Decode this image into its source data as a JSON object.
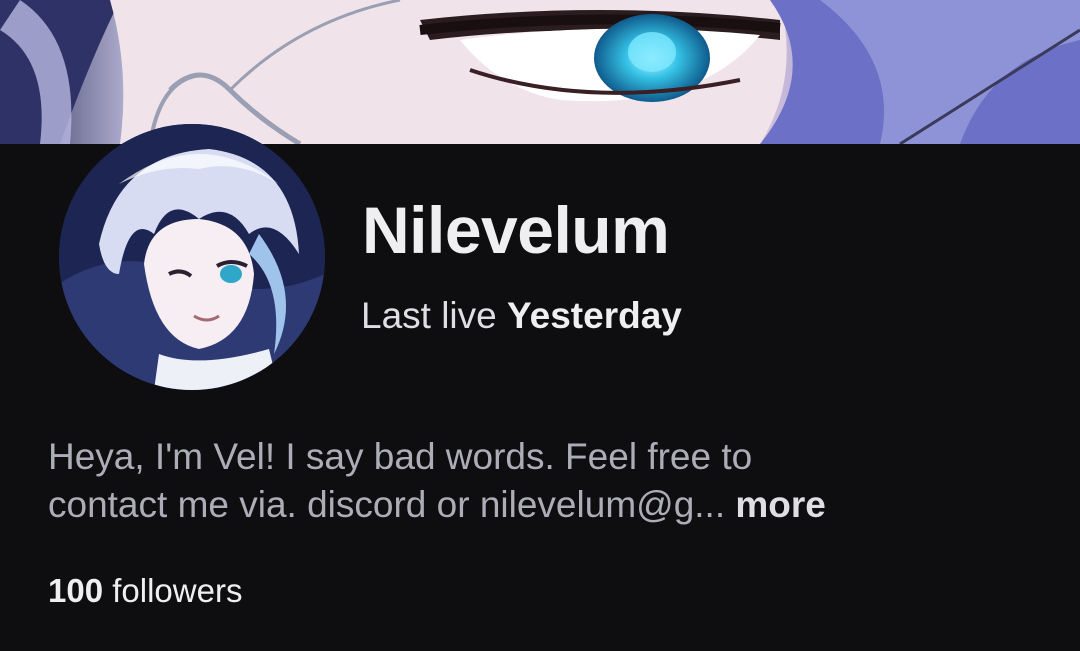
{
  "banner": {
    "image": "anime-eye-artwork-banner"
  },
  "avatar": {
    "image": "anime-character-avatar"
  },
  "channel": {
    "name": "Nilevelum",
    "last_live_label": "Last live",
    "last_live_value": "Yesterday"
  },
  "bio": {
    "line1": "Heya, I'm Vel! I say bad words. Feel free to",
    "line2": "contact me via. discord or nilevelum@g...",
    "more_label": "more"
  },
  "followers": {
    "count": "100",
    "label": "followers"
  },
  "colors": {
    "background": "#0e0e10",
    "text_primary": "#efeff1",
    "text_secondary": "#adadb8"
  }
}
